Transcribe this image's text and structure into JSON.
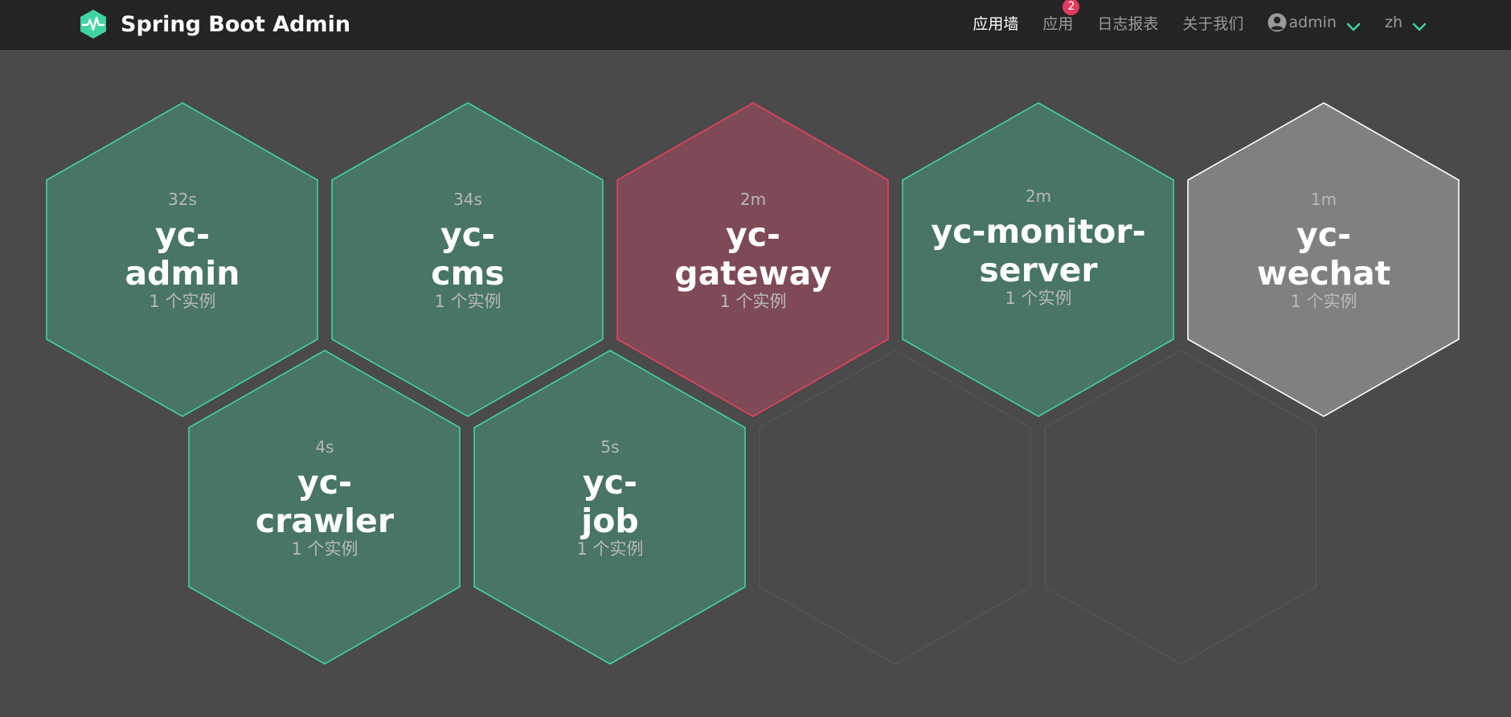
{
  "navbar": {
    "title": "Spring Boot Admin",
    "logo_icon": "heartbeat-icon",
    "items": {
      "wall": "应用墙",
      "applications": "应用",
      "applications_badge": "2",
      "journal": "日志报表",
      "about": "关于我们"
    },
    "user": "admin",
    "language": "zh"
  },
  "applications": [
    {
      "name_line1": "yc-",
      "name_line2": "admin",
      "time": "32s",
      "instances": "1 个实例",
      "status": "up"
    },
    {
      "name_line1": "yc-",
      "name_line2": "cms",
      "time": "34s",
      "instances": "1 个实例",
      "status": "up"
    },
    {
      "name_line1": "yc-",
      "name_line2": "gateway",
      "time": "2m",
      "instances": "1 个实例",
      "status": "down"
    },
    {
      "name_line1": "yc-monitor-",
      "name_line2": "server",
      "time": "2m",
      "instances": "1 个实例",
      "status": "up"
    },
    {
      "name_line1": "yc-",
      "name_line2": "wechat",
      "time": "1m",
      "instances": "1 个实例",
      "status": "unknown"
    },
    {
      "name_line1": "yc-",
      "name_line2": "crawler",
      "time": "4s",
      "instances": "1 个实例",
      "status": "up"
    },
    {
      "name_line1": "yc-",
      "name_line2": "job",
      "time": "5s",
      "instances": "1 个实例",
      "status": "up"
    }
  ],
  "colors": {
    "up_fill": "#487565",
    "up_stroke": "#42d3a5",
    "down_fill": "#7e4a55",
    "down_stroke": "#e8405e",
    "unknown_fill": "#808080",
    "unknown_stroke": "#ffffff",
    "empty_stroke": "#5a5a5a",
    "accent": "#42d3a5"
  }
}
